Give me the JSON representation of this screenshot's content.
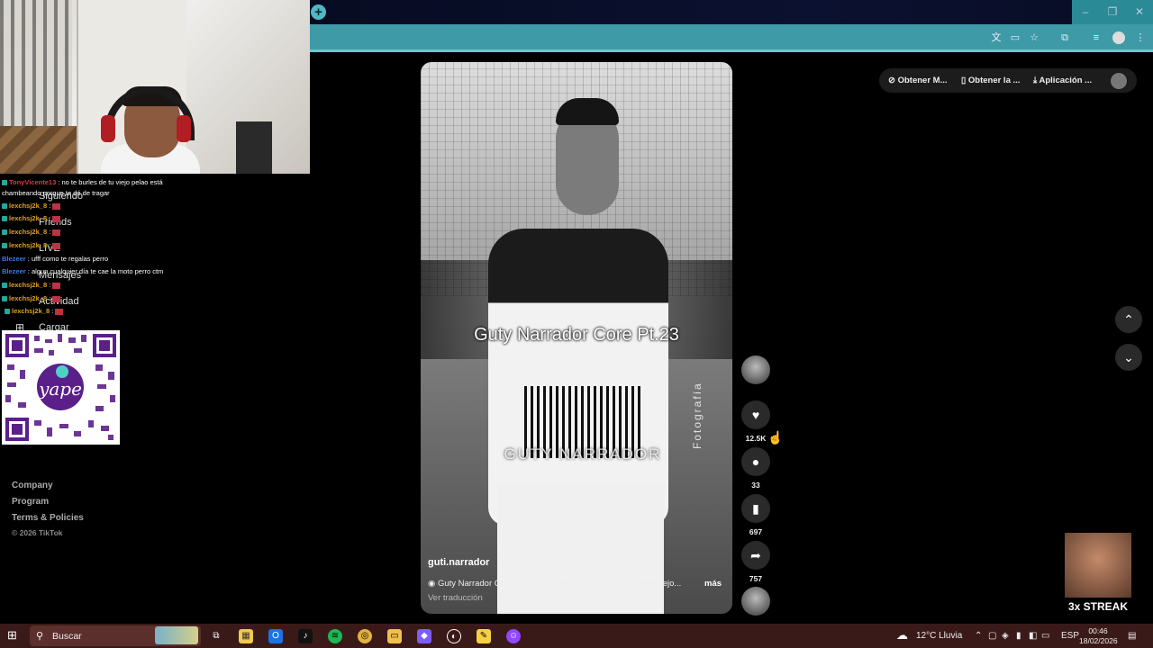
{
  "webcam": {},
  "sidebar": {
    "nav": [
      "Siguiendo",
      "Friends",
      "LIVE",
      "Mensajes",
      "Actividad",
      "Cargar"
    ],
    "footer": [
      "Company",
      "Program",
      "Terms & Policies",
      "© 2026 TikTok"
    ]
  },
  "chat": [
    {
      "user": "TonyVicente13",
      "text": ": no te burles de tu viejo pelao está",
      "color": "#e03a3a"
    },
    {
      "user": "",
      "text": "chambeando porque te dé de tragar",
      "color": "#ffffff"
    },
    {
      "user": "lexchsj2k_8",
      "text": ":",
      "color": "#e0a020"
    },
    {
      "user": "lexchsj2k_8",
      "text": ":",
      "color": "#e0a020"
    },
    {
      "user": "lexchsj2k_8",
      "text": ":",
      "color": "#e0a020"
    },
    {
      "user": "lexchsj2k_8",
      "text": ":",
      "color": "#e0a020"
    },
    {
      "user": "Blezeer",
      "text": ": ufff como te regalas perro",
      "color": "#3a7be0"
    },
    {
      "user": "Blezeer",
      "text": ": algun cualquier día te cae la moto perro ctm",
      "color": "#3a7be0"
    },
    {
      "user": "lexchsj2k_8",
      "text": ":",
      "color": "#e0a020"
    },
    {
      "user": "lexchsj2k_8",
      "text": ":",
      "color": "#e0a020"
    },
    {
      "user": "lexchsj2k_8",
      "text": ":",
      "color": "#e0a020"
    }
  ],
  "qr": {
    "brand": "yape"
  },
  "video": {
    "title": "Guty Narrador Core Pt.23",
    "watermark": "GUTY NARRADOR",
    "side_text": "Fotografía",
    "author": "guti.narrador",
    "caption": "Guty Narrador Core Pt.23#ChristianCueva #tiofritz #ninhoviejo...",
    "more": "más",
    "translate": "Ver traducción"
  },
  "actions": {
    "likes": "12.5K",
    "comments": "33",
    "saves": "697",
    "shares": "757"
  },
  "topbar": {
    "item1": "Obtener M...",
    "item2": "Obtener la ...",
    "item3": "Aplicación ..."
  },
  "streak": "3x STREAK",
  "taskbar": {
    "search_placeholder": "Buscar",
    "weather": "12°C  Lluvia",
    "lang": "ESP",
    "time": "00:46",
    "date": "18/02/2026"
  }
}
